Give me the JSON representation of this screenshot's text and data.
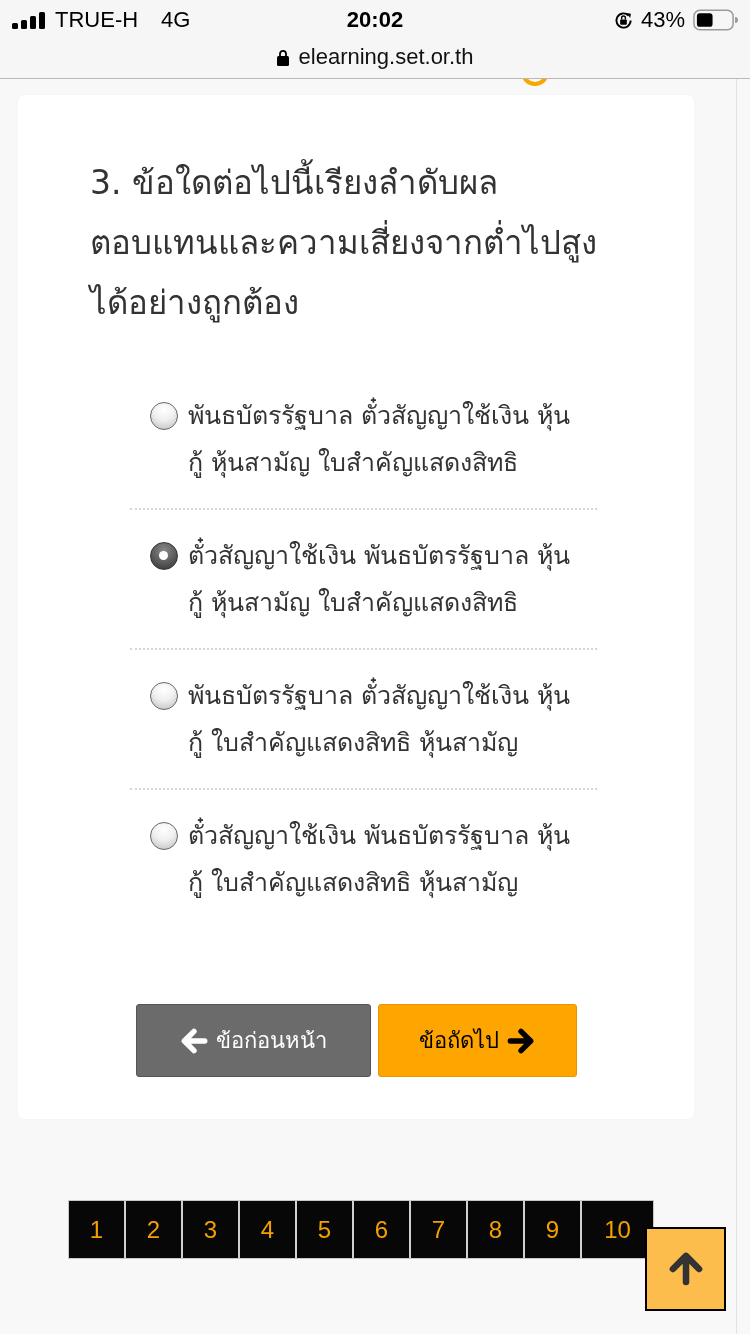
{
  "status_bar": {
    "carrier": "TRUE-H",
    "network": "4G",
    "time": "20:02",
    "battery": "43%"
  },
  "address_bar": {
    "url": "elearning.set.or.th"
  },
  "question": {
    "title": "3. ข้อใดต่อไปนี้เรียงลำดับผลตอบแทนและความเสี่ยงจากต่ำไปสูงได้อย่างถูกต้อง",
    "options": [
      {
        "label": "พันธบัตรรัฐบาล ตั๋วสัญญาใช้เงิน หุ้นกู้ หุ้นสามัญ ใบสำคัญแสดงสิทธิ",
        "selected": false
      },
      {
        "label": "ตั๋วสัญญาใช้เงิน พันธบัตรรัฐบาล หุ้นกู้ หุ้นสามัญ ใบสำคัญแสดงสิทธิ",
        "selected": true
      },
      {
        "label": "พันธบัตรรัฐบาล ตั๋วสัญญาใช้เงิน หุ้นกู้ ใบสำคัญแสดงสิทธิ หุ้นสามัญ",
        "selected": false
      },
      {
        "label": "ตั๋วสัญญาใช้เงิน พันธบัตรรัฐบาล หุ้นกู้ ใบสำคัญแสดงสิทธิ หุ้นสามัญ",
        "selected": false
      }
    ]
  },
  "navigation": [
    {
      "kind": "previous",
      "label": "ข้อก่อนหน้า"
    },
    {
      "kind": "next",
      "label": "ข้อถัดไป"
    }
  ],
  "pagination": [
    "1",
    "2",
    "3",
    "4",
    "5",
    "6",
    "7",
    "8",
    "9",
    "10"
  ]
}
